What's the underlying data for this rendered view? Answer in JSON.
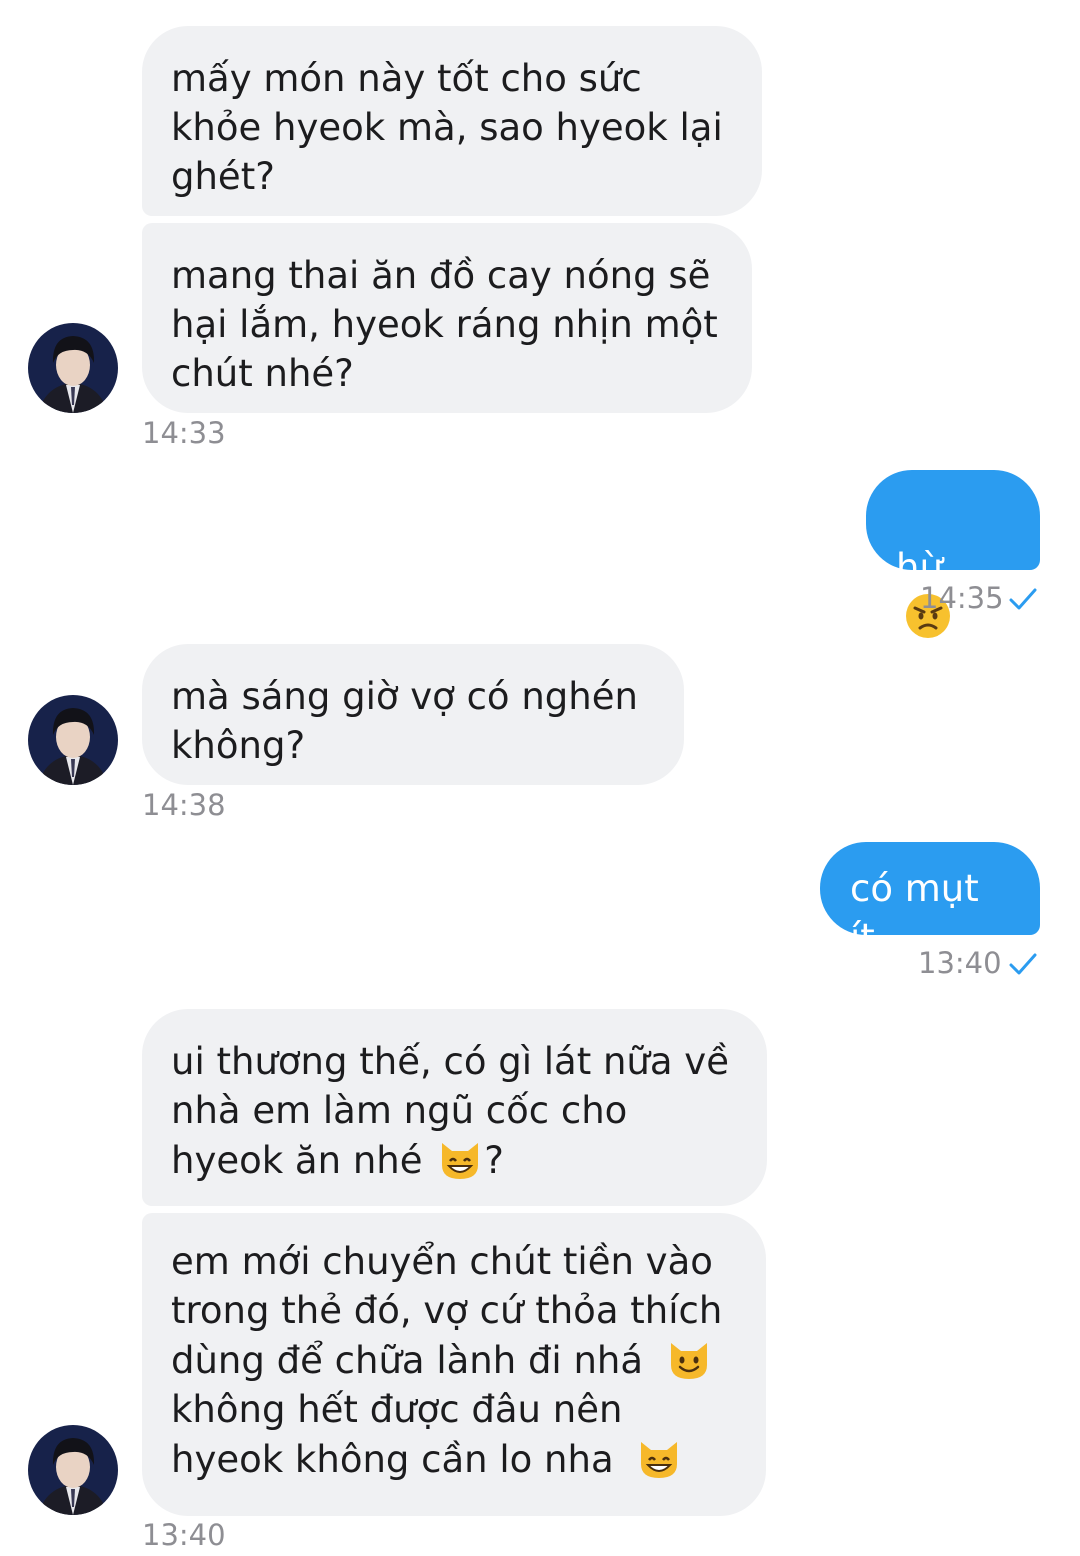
{
  "messages": [
    {
      "id": "m1",
      "side": "in",
      "text": "mấy món này tốt cho sức\nkhỏe hyeok mà, sao hyeok lại\nghét?"
    },
    {
      "id": "m2",
      "side": "in",
      "text": "mang thai ăn đồ cay nóng sẽ\nhại lắm, hyeok ráng nhịn một\nchút nhé?",
      "time": "14:33"
    },
    {
      "id": "m3",
      "side": "out",
      "text": "hừ",
      "emoji": "angry-face",
      "time": "14:35",
      "status": "sent-check"
    },
    {
      "id": "m4",
      "side": "in",
      "text": "mà sáng giờ vợ có nghén\nkhông?",
      "time": "14:38"
    },
    {
      "id": "m5",
      "side": "out",
      "text": "có mụt ít",
      "time": "13:40",
      "status": "sent-check"
    },
    {
      "id": "m6",
      "side": "in",
      "text_lines": [
        "ui thương thế, có gì lát nữa về",
        "nhà em làm ngũ cốc cho",
        "hyeok ăn nhé"
      ],
      "text_after_emoji": "?",
      "emoji": "grinning-cat"
    },
    {
      "id": "m7",
      "side": "in",
      "lines": [
        {
          "text": "em mới chuyển chút tiền vào"
        },
        {
          "text": "trong thẻ đó, vợ cứ thỏa thích"
        },
        {
          "text": "dùng để chữa lành đi nhá",
          "emoji": "smiling-cat"
        },
        {
          "text": "không hết được đâu nên"
        },
        {
          "text": "hyeok không cần lo nha",
          "emoji": "grinning-cat"
        }
      ],
      "time": "13:40"
    }
  ],
  "colors": {
    "incoming_bg": "#f0f1f3",
    "outgoing_bg": "#2b9cf0",
    "timestamp": "#8e8e93",
    "check": "#2b9cf0"
  }
}
